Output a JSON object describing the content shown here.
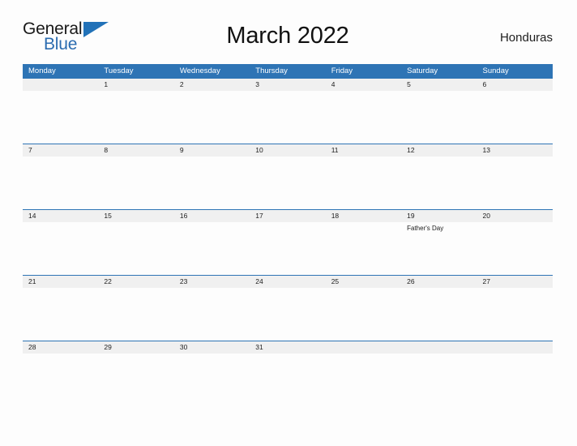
{
  "brand": {
    "name_part1": "General",
    "name_part2": "Blue",
    "flag_icon": "triangle-flag-icon",
    "color_primary": "#2272b8",
    "color_text": "#1a1a1a"
  },
  "header": {
    "title": "March 2022",
    "country": "Honduras"
  },
  "calendar": {
    "header_color": "#2e74b5",
    "day_strip_color": "#f0f0f0",
    "weekdays": [
      "Monday",
      "Tuesday",
      "Wednesday",
      "Thursday",
      "Friday",
      "Saturday",
      "Sunday"
    ],
    "weeks": [
      {
        "days": [
          {
            "date": "",
            "note": ""
          },
          {
            "date": "1",
            "note": ""
          },
          {
            "date": "2",
            "note": ""
          },
          {
            "date": "3",
            "note": ""
          },
          {
            "date": "4",
            "note": ""
          },
          {
            "date": "5",
            "note": ""
          },
          {
            "date": "6",
            "note": ""
          }
        ]
      },
      {
        "days": [
          {
            "date": "7",
            "note": ""
          },
          {
            "date": "8",
            "note": ""
          },
          {
            "date": "9",
            "note": ""
          },
          {
            "date": "10",
            "note": ""
          },
          {
            "date": "11",
            "note": ""
          },
          {
            "date": "12",
            "note": ""
          },
          {
            "date": "13",
            "note": ""
          }
        ]
      },
      {
        "days": [
          {
            "date": "14",
            "note": ""
          },
          {
            "date": "15",
            "note": ""
          },
          {
            "date": "16",
            "note": ""
          },
          {
            "date": "17",
            "note": ""
          },
          {
            "date": "18",
            "note": ""
          },
          {
            "date": "19",
            "note": "Father's Day"
          },
          {
            "date": "20",
            "note": ""
          }
        ]
      },
      {
        "days": [
          {
            "date": "21",
            "note": ""
          },
          {
            "date": "22",
            "note": ""
          },
          {
            "date": "23",
            "note": ""
          },
          {
            "date": "24",
            "note": ""
          },
          {
            "date": "25",
            "note": ""
          },
          {
            "date": "26",
            "note": ""
          },
          {
            "date": "27",
            "note": ""
          }
        ]
      },
      {
        "days": [
          {
            "date": "28",
            "note": ""
          },
          {
            "date": "29",
            "note": ""
          },
          {
            "date": "30",
            "note": ""
          },
          {
            "date": "31",
            "note": ""
          },
          {
            "date": "",
            "note": ""
          },
          {
            "date": "",
            "note": ""
          },
          {
            "date": "",
            "note": ""
          }
        ]
      }
    ]
  }
}
